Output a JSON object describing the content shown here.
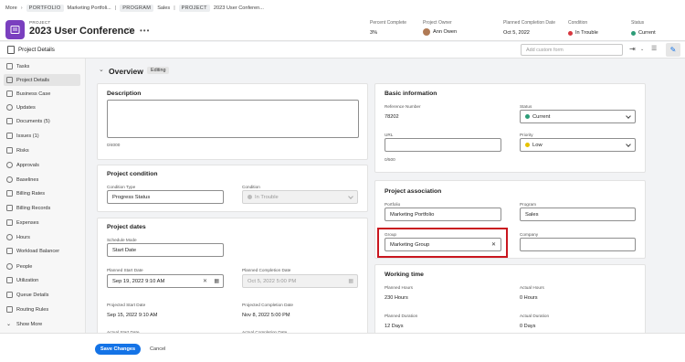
{
  "breadcrumb": {
    "more": "More",
    "portfolio_tag": "PORTFOLIO",
    "portfolio_name": "Marketing Portfoli...",
    "program_tag": "PROGRAM",
    "program_name": "Sales",
    "project_tag": "PROJECT",
    "project_name": "2023 User Conferen..."
  },
  "header": {
    "type_label": "PROJECT",
    "title": "2023 User Conference",
    "percent_complete_label": "Percent Complete",
    "percent_complete": "3%",
    "owner_label": "Project Owner",
    "owner": "Ann Owen",
    "planned_completion_label": "Planned Completion Date",
    "planned_completion": "Oct 5, 2022",
    "condition_label": "Condition",
    "condition": "In Trouble",
    "status_label": "Status",
    "status": "Current"
  },
  "subbar": {
    "section_title": "Project Details",
    "custom_form_placeholder": "Add custom form"
  },
  "sidebar": {
    "items": [
      {
        "label": "Tasks"
      },
      {
        "label": "Project Details"
      },
      {
        "label": "Business Case"
      },
      {
        "label": "Updates"
      },
      {
        "label": "Documents (5)"
      },
      {
        "label": "Issues (1)"
      },
      {
        "label": "Risks"
      },
      {
        "label": "Approvals"
      },
      {
        "label": "Baselines"
      },
      {
        "label": "Billing Rates"
      },
      {
        "label": "Billing Records"
      },
      {
        "label": "Expenses"
      },
      {
        "label": "Hours"
      },
      {
        "label": "Workload Balancer"
      },
      {
        "label": "People"
      },
      {
        "label": "Utilization"
      },
      {
        "label": "Queue Details"
      },
      {
        "label": "Routing Rules"
      },
      {
        "label": "Show More"
      }
    ]
  },
  "overview": {
    "title": "Overview",
    "badge": "Editing"
  },
  "description": {
    "title": "Description",
    "counter": "0/4000"
  },
  "project_condition": {
    "title": "Project condition",
    "condition_type_label": "Condition Type",
    "condition_type": "Progress Status",
    "condition_label": "Condition",
    "condition": "In Trouble"
  },
  "project_dates": {
    "title": "Project dates",
    "schedule_mode_label": "Schedule Mode",
    "schedule_mode": "Start Date",
    "planned_start_label": "Planned Start Date",
    "planned_start": "Sep 19, 2022 9:10 AM",
    "planned_completion_label": "Planned Completion Date",
    "planned_completion": "Oct 5, 2022 5:00 PM",
    "projected_start_label": "Projected Start Date",
    "projected_start": "Sep 15, 2022 9:10 AM",
    "projected_completion_label": "Projected Completion Date",
    "projected_completion": "Nov 8, 2022 5:00 PM",
    "actual_start_label": "Actual Start Date",
    "actual_completion_label": "Actual Completion Date"
  },
  "basic_info": {
    "title": "Basic information",
    "reference_label": "Reference Number",
    "reference": "78202",
    "status_label": "Status",
    "status": "Current",
    "url_label": "URL",
    "url_counter": "0/500",
    "priority_label": "Priority",
    "priority": "Low"
  },
  "project_association": {
    "title": "Project association",
    "portfolio_label": "Portfolio",
    "portfolio": "Marketing Portfolio",
    "program_label": "Program",
    "program": "Sales",
    "group_label": "Group",
    "group": "Marketing Group",
    "company_label": "Company"
  },
  "working_time": {
    "title": "Working time",
    "planned_hours_label": "Planned Hours",
    "planned_hours": "230 Hours",
    "actual_hours_label": "Actual Hours",
    "actual_hours": "0 Hours",
    "planned_duration_label": "Planned Duration",
    "planned_duration": "12 Days",
    "actual_duration_label": "Actual Duration",
    "actual_duration": "0 Days"
  },
  "footer": {
    "save_label": "Save Changes",
    "cancel_label": "Cancel"
  },
  "colors": {
    "accent": "#1473e6",
    "project_icon": "#7a3fbf",
    "in_trouble": "#d7373f",
    "current": "#2d9d78",
    "low_priority": "#e6c200",
    "highlight": "#c9161f"
  }
}
